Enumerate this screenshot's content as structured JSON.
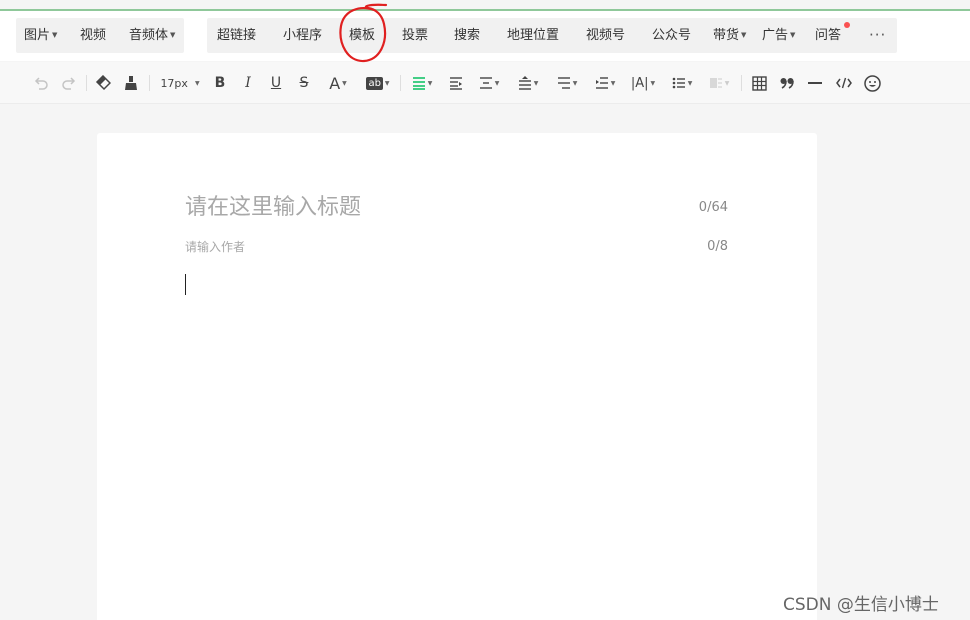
{
  "insert_menu": {
    "left_items": [
      {
        "label": "图片",
        "dropdown": true
      },
      {
        "label": "视频",
        "dropdown": false
      },
      {
        "label": "音频体",
        "dropdown": true
      }
    ],
    "right_items": [
      {
        "label": "超链接",
        "dropdown": false
      },
      {
        "label": "小程序",
        "dropdown": false
      },
      {
        "label": "模板",
        "dropdown": false
      },
      {
        "label": "投票",
        "dropdown": false
      },
      {
        "label": "搜索",
        "dropdown": false
      },
      {
        "label": "地理位置",
        "dropdown": false
      },
      {
        "label": "视频号",
        "dropdown": false
      },
      {
        "label": "公众号",
        "dropdown": false
      },
      {
        "label": "带货",
        "dropdown": true
      },
      {
        "label": "广告",
        "dropdown": true
      },
      {
        "label": "问答",
        "dropdown": false,
        "badge": "red-dot"
      }
    ],
    "more_label": "···"
  },
  "toolbar": {
    "font_size": "17px",
    "bold": "B",
    "italic": "I",
    "underline": "U",
    "strike": "S",
    "font_color": "A",
    "highlight": "ab",
    "tools": [
      "undo-icon",
      "redo-icon",
      "clear-format-icon",
      "format-painter-icon",
      "font-size-select",
      "bold-icon",
      "italic-icon",
      "underline-icon",
      "strikethrough-icon",
      "font-color-icon",
      "highlight-icon",
      "align-icon",
      "indent-icon",
      "line-spacing-icon",
      "paragraph-spacing-icon",
      "text-indent-icon",
      "letter-spacing-icon",
      "list-icon",
      "layout-icon",
      "table-icon",
      "quote-icon",
      "divider-icon",
      "code-icon",
      "emoji-icon"
    ]
  },
  "editor": {
    "title_placeholder": "请在这里输入标题",
    "title_value": "",
    "title_count": "0/64",
    "author_placeholder": "请输入作者",
    "author_value": "",
    "author_count": "0/8"
  },
  "watermark": "CSDN @生信小博士",
  "colors": {
    "accent_green": "#07c160",
    "top_line": "#8fc89a",
    "annotation_red": "#e02020",
    "badge_red": "#fa5151"
  }
}
